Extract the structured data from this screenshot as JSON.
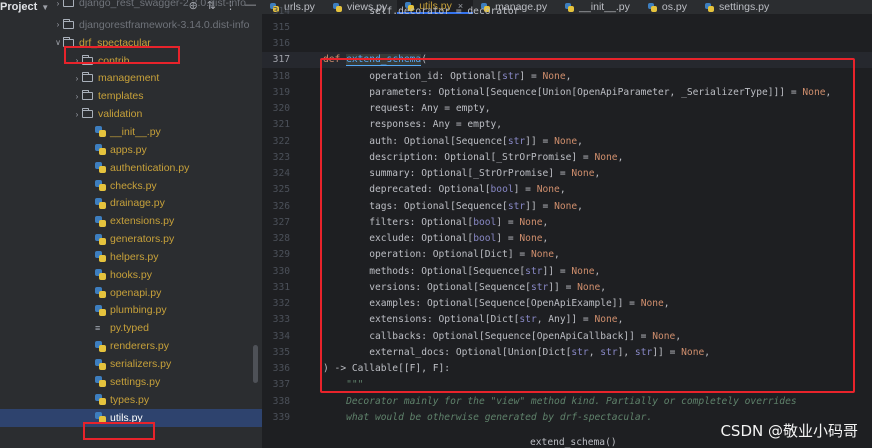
{
  "project_panel": {
    "title": "Project",
    "tree": [
      {
        "label": "django_rest_swagger-2.2.0.dist-info",
        "type": "folder",
        "expanded": false
      },
      {
        "label": "djangorestframework-3.14.0.dist-info",
        "type": "folder",
        "expanded": false
      },
      {
        "label": "drf_spectacular",
        "type": "folder",
        "expanded": true
      },
      {
        "label": "contrib",
        "type": "folder",
        "expanded": false
      },
      {
        "label": "management",
        "type": "folder",
        "expanded": false
      },
      {
        "label": "templates",
        "type": "folder",
        "expanded": false
      },
      {
        "label": "validation",
        "type": "folder",
        "expanded": false
      },
      {
        "label": "__init__.py",
        "type": "py"
      },
      {
        "label": "apps.py",
        "type": "py"
      },
      {
        "label": "authentication.py",
        "type": "py"
      },
      {
        "label": "checks.py",
        "type": "py"
      },
      {
        "label": "drainage.py",
        "type": "py"
      },
      {
        "label": "extensions.py",
        "type": "py"
      },
      {
        "label": "generators.py",
        "type": "py"
      },
      {
        "label": "helpers.py",
        "type": "py"
      },
      {
        "label": "hooks.py",
        "type": "py"
      },
      {
        "label": "openapi.py",
        "type": "py"
      },
      {
        "label": "plumbing.py",
        "type": "py"
      },
      {
        "label": "py.typed",
        "type": "typed"
      },
      {
        "label": "renderers.py",
        "type": "py"
      },
      {
        "label": "serializers.py",
        "type": "py"
      },
      {
        "label": "settings.py",
        "type": "py"
      },
      {
        "label": "types.py",
        "type": "py"
      },
      {
        "label": "utils.py",
        "type": "py",
        "selected": true
      }
    ]
  },
  "tabs": [
    {
      "label": "urls.py"
    },
    {
      "label": "views.py"
    },
    {
      "label": "utils.py",
      "active": true
    },
    {
      "label": "manage.py"
    },
    {
      "label": "__init__.py"
    },
    {
      "label": "os.py"
    },
    {
      "label": "settings.py"
    }
  ],
  "code_lines": [
    {
      "n": "314",
      "text": "        self.decorator = decorator"
    },
    {
      "n": "315",
      "text": ""
    },
    {
      "n": "316",
      "text": ""
    },
    {
      "n": "317",
      "text": "def extend_schema("
    },
    {
      "n": "318",
      "text": "        operation_id: Optional[str] = None,"
    },
    {
      "n": "319",
      "text": "        parameters: Optional[Sequence[Union[OpenApiParameter, _SerializerType]]] = None,"
    },
    {
      "n": "320",
      "text": "        request: Any = empty,"
    },
    {
      "n": "321",
      "text": "        responses: Any = empty,"
    },
    {
      "n": "322",
      "text": "        auth: Optional[Sequence[str]] = None,"
    },
    {
      "n": "323",
      "text": "        description: Optional[_StrOrPromise] = None,"
    },
    {
      "n": "324",
      "text": "        summary: Optional[_StrOrPromise] = None,"
    },
    {
      "n": "325",
      "text": "        deprecated: Optional[bool] = None,"
    },
    {
      "n": "326",
      "text": "        tags: Optional[Sequence[str]] = None,"
    },
    {
      "n": "327",
      "text": "        filters: Optional[bool] = None,"
    },
    {
      "n": "328",
      "text": "        exclude: Optional[bool] = None,"
    },
    {
      "n": "329",
      "text": "        operation: Optional[Dict] = None,"
    },
    {
      "n": "330",
      "text": "        methods: Optional[Sequence[str]] = None,"
    },
    {
      "n": "331",
      "text": "        versions: Optional[Sequence[str]] = None,"
    },
    {
      "n": "332",
      "text": "        examples: Optional[Sequence[OpenApiExample]] = None,"
    },
    {
      "n": "333",
      "text": "        extensions: Optional[Dict[str, Any]] = None,"
    },
    {
      "n": "334",
      "text": "        callbacks: Optional[Sequence[OpenApiCallback]] = None,"
    },
    {
      "n": "335",
      "text": "        external_docs: Optional[Union[Dict[str, str], str]] = None,"
    },
    {
      "n": "336",
      "text": ") -> Callable[[F], F]:"
    },
    {
      "n": "337",
      "text": "    \"\"\""
    },
    {
      "n": "338",
      "text": "    Decorator mainly for the \"view\" method kind. Partially or completely overrides"
    },
    {
      "n": "339",
      "text": "    what would be otherwise generated by drf-spectacular."
    }
  ],
  "bottom_breadcrumb": "extend_schema()",
  "watermark": "CSDN @敬业小码哥",
  "colors": {
    "highlight": "#e8232b",
    "selection": "#2e436e",
    "accent": "#3574f0"
  }
}
